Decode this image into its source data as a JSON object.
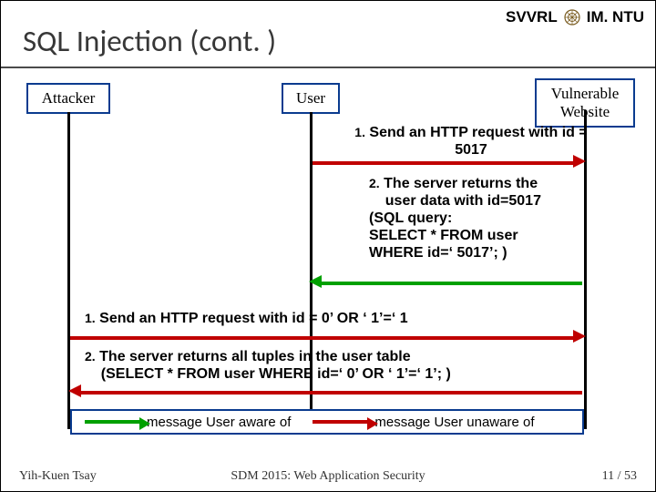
{
  "header": {
    "lab": "SVVRL",
    "inst": "IM. NTU"
  },
  "title": "SQL Injection (cont. )",
  "actors": {
    "attacker": "Attacker",
    "user": "User",
    "website_l1": "Vulnerable",
    "website_l2": "Website"
  },
  "messages": {
    "m1_num": "1.",
    "m1": "Send an HTTP request with id = 5017",
    "m2_num": "2.",
    "m2_l1": "The server returns the",
    "m2_l2": "user data with id=5017",
    "m2_l3": "(SQL query:",
    "m2_l4": "SELECT * FROM user",
    "m2_l5": "WHERE id=‘ 5017’; )",
    "m3_num": "1.",
    "m3": "Send an HTTP request with id = 0’ OR ‘ 1’=‘ 1",
    "m4_num": "2.",
    "m4_l1": "The server returns all tuples in the user table",
    "m4_l2": "(SELECT * FROM user WHERE id=‘ 0’ OR ‘ 1’=‘ 1’; )"
  },
  "legend": {
    "aware": "message User aware of",
    "unaware": "message User unaware of"
  },
  "footer": {
    "author": "Yih-Kuen Tsay",
    "venue": "SDM 2015: Web Application Security",
    "page": "11 / 53"
  },
  "chart_data": {
    "type": "sequence-diagram",
    "actors": [
      "Attacker",
      "User",
      "Vulnerable Website"
    ],
    "messages": [
      {
        "from": "User",
        "to": "Vulnerable Website",
        "label": "1. Send an HTTP request with id = 5017",
        "kind": "unaware"
      },
      {
        "from": "Vulnerable Website",
        "to": "User",
        "label": "2. The server returns the user data with id=5017 (SQL query: SELECT * FROM user WHERE id='5017';)",
        "kind": "aware"
      },
      {
        "from": "Attacker",
        "to": "Vulnerable Website",
        "label": "1. Send an HTTP request with id = 0' OR '1'='1",
        "kind": "unaware"
      },
      {
        "from": "Vulnerable Website",
        "to": "Attacker",
        "label": "2. The server returns all tuples in the user table (SELECT * FROM user WHERE id='0' OR '1'='1';)",
        "kind": "unaware"
      }
    ],
    "legend": {
      "aware": "message User aware of",
      "unaware": "message User unaware of"
    }
  }
}
